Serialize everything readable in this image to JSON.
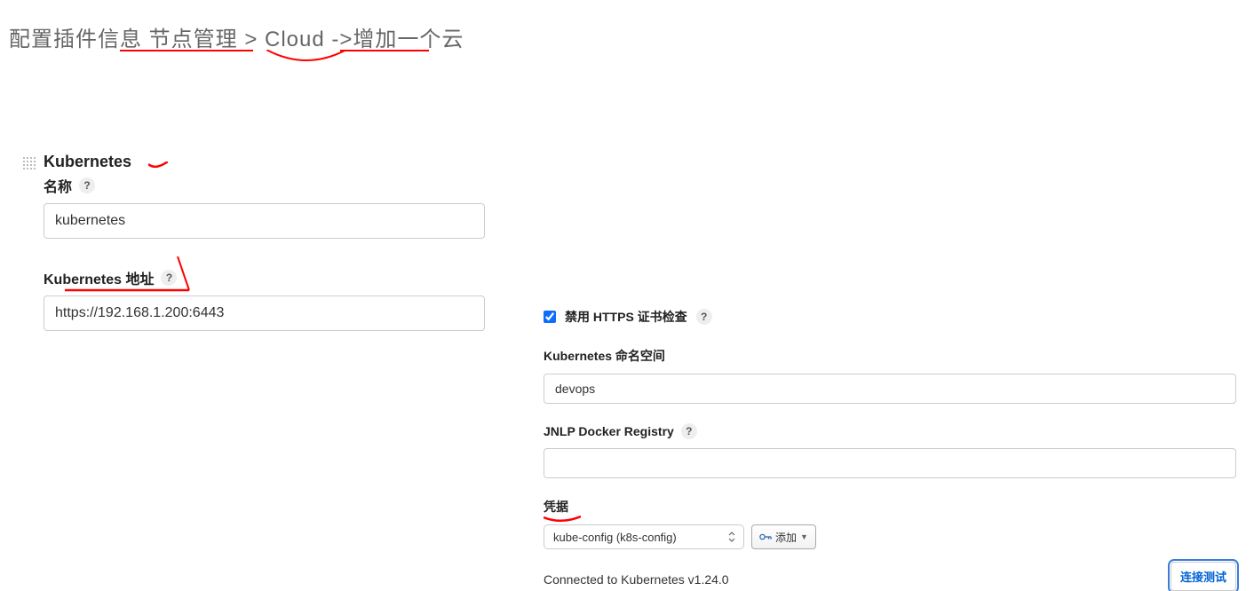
{
  "page": {
    "title": "配置插件信息 节点管理 > Cloud ->增加一个云"
  },
  "left": {
    "section_heading": "Kubernetes",
    "name_label": "名称",
    "name_value": "kubernetes",
    "address_label": "Kubernetes 地址",
    "address_value": "https://192.168.1.200:6443"
  },
  "right": {
    "disable_https_label": "禁用 HTTPS 证书检查",
    "disable_https_checked": true,
    "namespace_label": "Kubernetes 命名空间",
    "namespace_value": "devops",
    "jnlp_label": "JNLP Docker Registry",
    "jnlp_value": "",
    "credentials_label": "凭据",
    "credentials_selected": "kube-config (k8s-config)",
    "add_button_label": "添加",
    "status_text": "Connected to Kubernetes v1.24.0",
    "test_button_label": "连接测试"
  },
  "help_tooltip": "?",
  "colors": {
    "annotation_red": "#ff0000",
    "primary_blue": "#0062d6"
  }
}
